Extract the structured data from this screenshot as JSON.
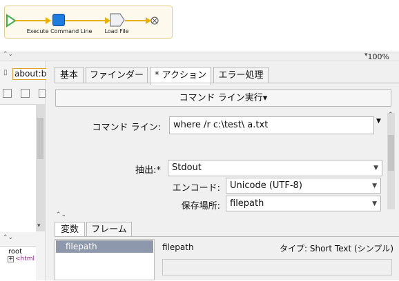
{
  "workflow": {
    "steps": [
      {
        "label": "Execute Command Line"
      },
      {
        "label": "Load File"
      }
    ]
  },
  "toolbar": {
    "zoom": "100%"
  },
  "left_panel": {
    "doc_tab": "about:b",
    "tree": {
      "root_label": "root",
      "child_label": "<html"
    }
  },
  "tabs": [
    {
      "label": "基本"
    },
    {
      "label": "ファインダー"
    },
    {
      "label": "* アクション",
      "active": true
    },
    {
      "label": "エラー処理"
    }
  ],
  "action_button": {
    "label": "コマンド ライン実行",
    "arrow": "▾"
  },
  "form": {
    "command_line": {
      "label": "コマンド ライン:",
      "value": "where /r c:\\test\\ a.txt"
    },
    "extract": {
      "label": "抽出:",
      "required_mark": "*",
      "value": "Stdout"
    },
    "encoding": {
      "label": "エンコード:",
      "value": "Unicode (UTF-8)"
    },
    "save_location": {
      "label": "保存場所:",
      "value": "filepath"
    }
  },
  "lower_tabs": [
    {
      "label": "変数",
      "active": true
    },
    {
      "label": "フレーム"
    }
  ],
  "variables": {
    "items": [
      {
        "name": "filepath"
      }
    ],
    "detail": {
      "name": "filepath",
      "type": "タイプ: Short Text (シンプル)"
    }
  },
  "colors": {
    "flow_accent": "#e8b000",
    "step_blue": "#1e7be0",
    "selected_row": "#8e98ad"
  }
}
